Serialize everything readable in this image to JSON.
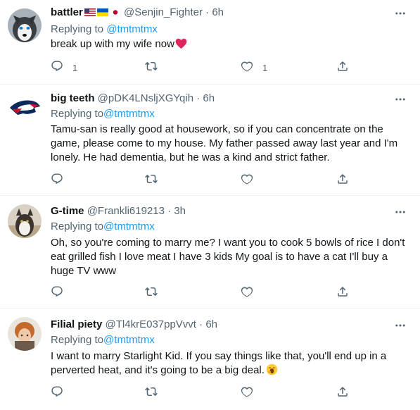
{
  "tweets": [
    {
      "name": "battler",
      "handle": "@Senjin_Fighter",
      "dot": "·",
      "time": "6h",
      "replying_prefix": "Replying to ",
      "replying_to": "@tmtmtmx",
      "text": "break up with my wife now",
      "reply_count": "1",
      "retweet_count": "",
      "like_count": "1"
    },
    {
      "name": "big teeth",
      "handle": "@pDK4LNsljXGYqih",
      "dot": "·",
      "time": "6h",
      "replying_prefix": "Replying to",
      "replying_to": "@tmtmtmx",
      "text": "Tamu-san is really good at housework, so if you can concentrate on the game, please come to my house. My father passed away last year and I'm lonely. He had dementia, but he was a kind and strict father.",
      "reply_count": "",
      "retweet_count": "",
      "like_count": ""
    },
    {
      "name": "G-time",
      "handle": "@Frankli619213",
      "dot": "·",
      "time": "3h",
      "replying_prefix": "Replying to",
      "replying_to": "@tmtmtmx",
      "text": "Oh, so you're coming to marry me? I want you to cook 5 bowls of rice I don't eat grilled fish I love meat I have 3 kids My goal is to have a cat I'll buy a huge TV www",
      "reply_count": "",
      "retweet_count": "",
      "like_count": ""
    },
    {
      "name": "Filial piety",
      "handle": "@Tl4krE037ppVvvt",
      "dot": "·",
      "time": "6h",
      "replying_prefix": "Replying to",
      "replying_to": "@tmtmtmx",
      "text": "I want to marry Starlight Kid. If you say things like that, you'll end up in a perverted heat, and it's going to be a big deal.",
      "reply_count": "",
      "retweet_count": "",
      "like_count": ""
    }
  ],
  "icons": {
    "reply": "reply-icon",
    "retweet": "retweet-icon",
    "like": "heart-icon",
    "share": "share-icon",
    "more": "more-icon"
  },
  "colors": {
    "link": "#1d9bf0",
    "secondary_text": "#536471",
    "heart_emoji": "#f91880",
    "divider": "#eff3f4"
  }
}
